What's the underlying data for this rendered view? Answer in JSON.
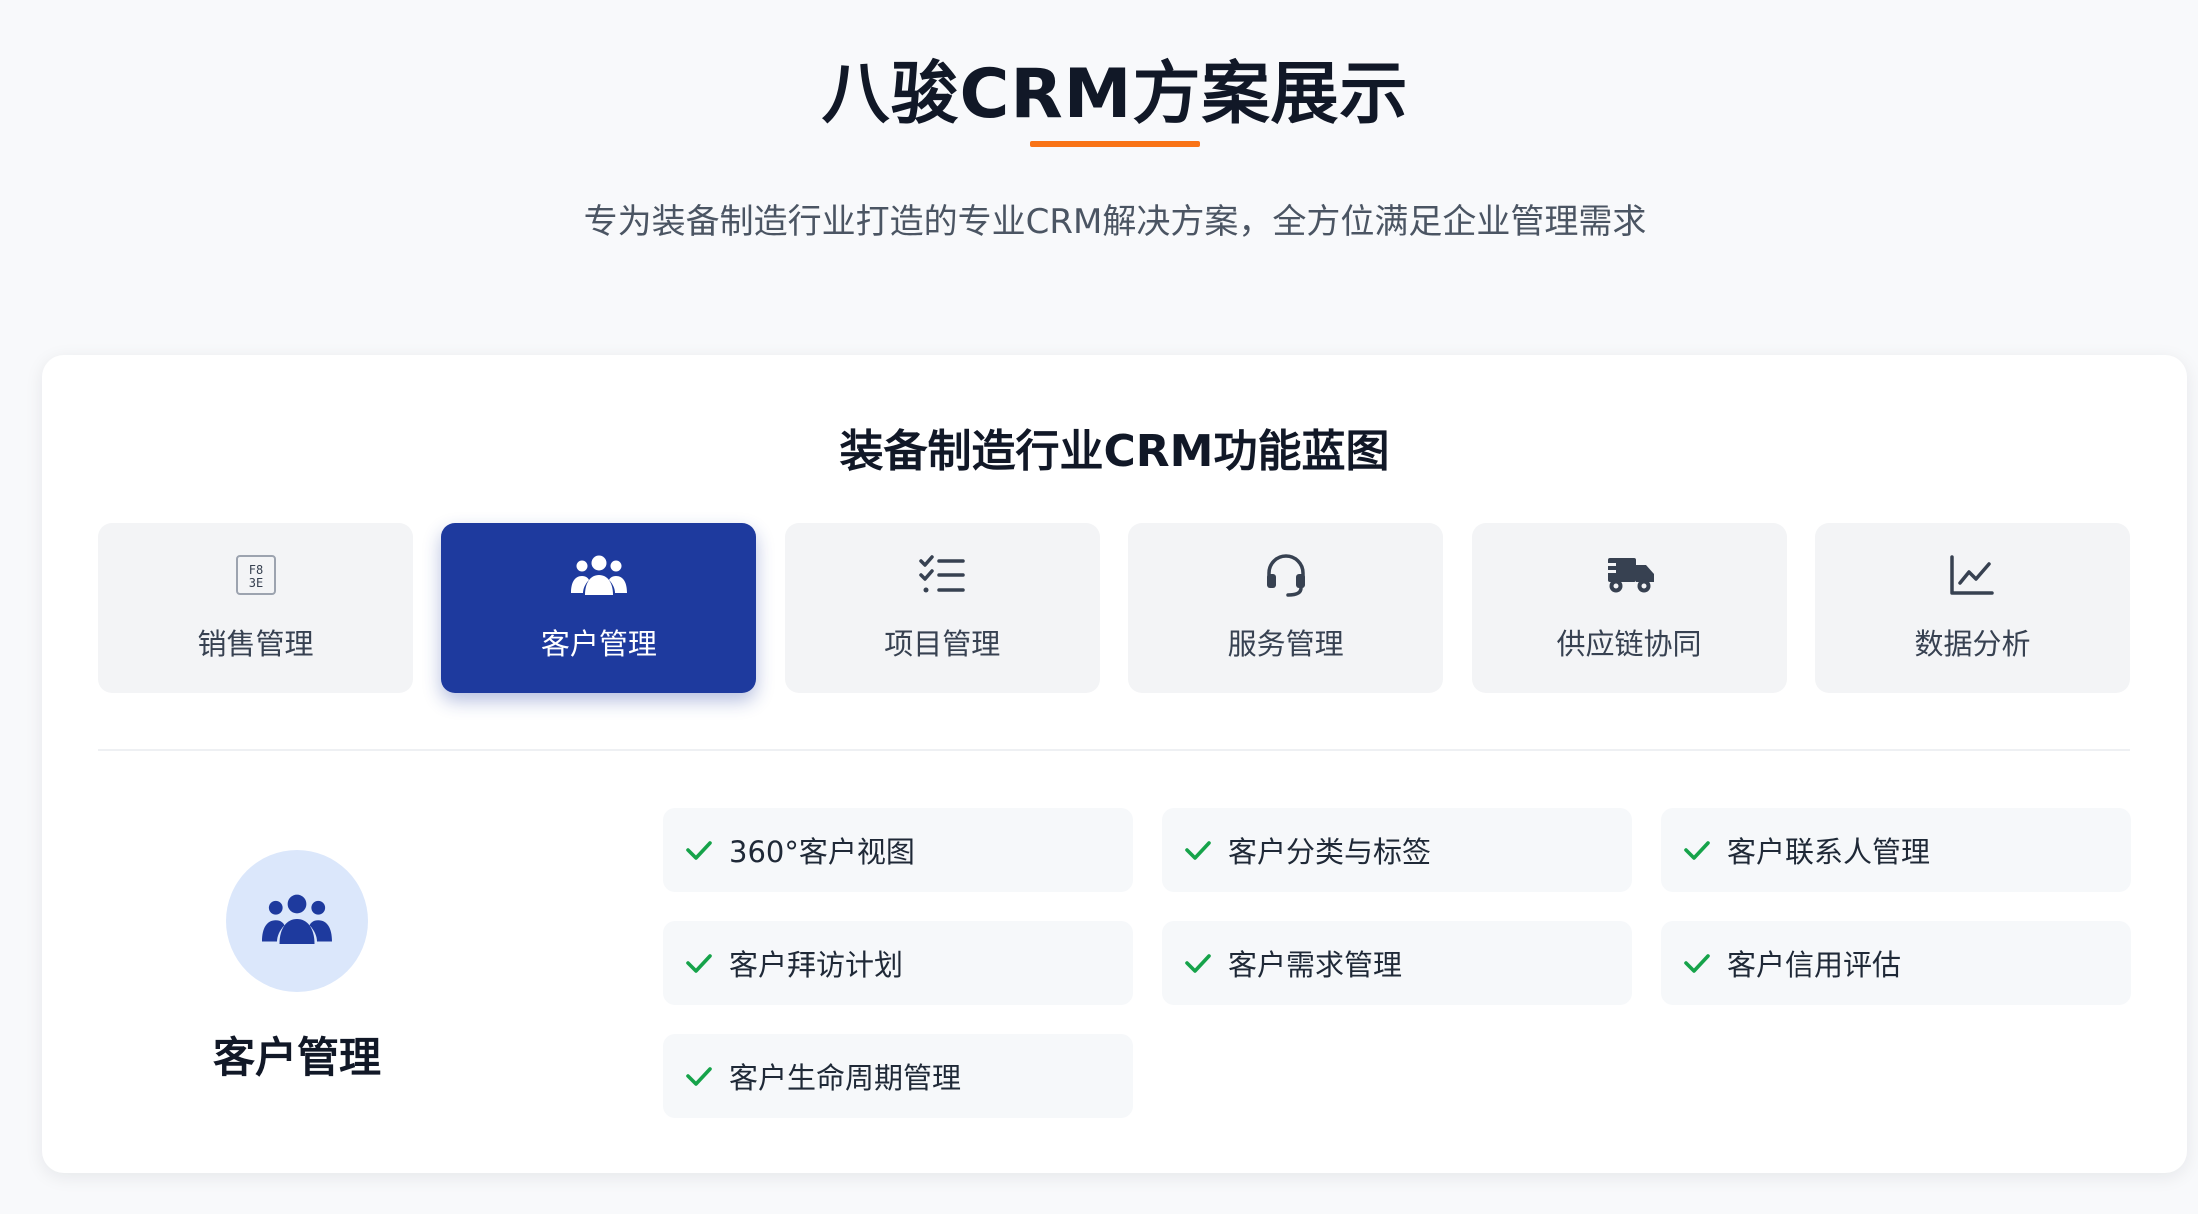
{
  "hero": {
    "title": "八骏CRM方案展示",
    "subtitle": "专为装备制造行业打造的专业CRM解决方案，全方位满足企业管理需求"
  },
  "colors": {
    "accent": "#f97316",
    "primary": "#1e3a9e",
    "check": "#16a34a",
    "circle_bg": "#dbe7fb"
  },
  "blueprint": {
    "title": "装备制造行业CRM功能蓝图",
    "tabs": [
      {
        "label": "销售管理",
        "icon": "sales-icon",
        "active": false
      },
      {
        "label": "客户管理",
        "icon": "users-icon",
        "active": true
      },
      {
        "label": "项目管理",
        "icon": "checklist-icon",
        "active": false
      },
      {
        "label": "服务管理",
        "icon": "headset-icon",
        "active": false
      },
      {
        "label": "供应链协同",
        "icon": "truck-icon",
        "active": false
      },
      {
        "label": "数据分析",
        "icon": "line-chart-icon",
        "active": false
      }
    ],
    "selected": {
      "title": "客户管理",
      "icon": "users-icon",
      "features": [
        "360°客户视图",
        "客户分类与标签",
        "客户联系人管理",
        "客户拜访计划",
        "客户需求管理",
        "客户信用评估",
        "客户生命周期管理"
      ]
    }
  }
}
